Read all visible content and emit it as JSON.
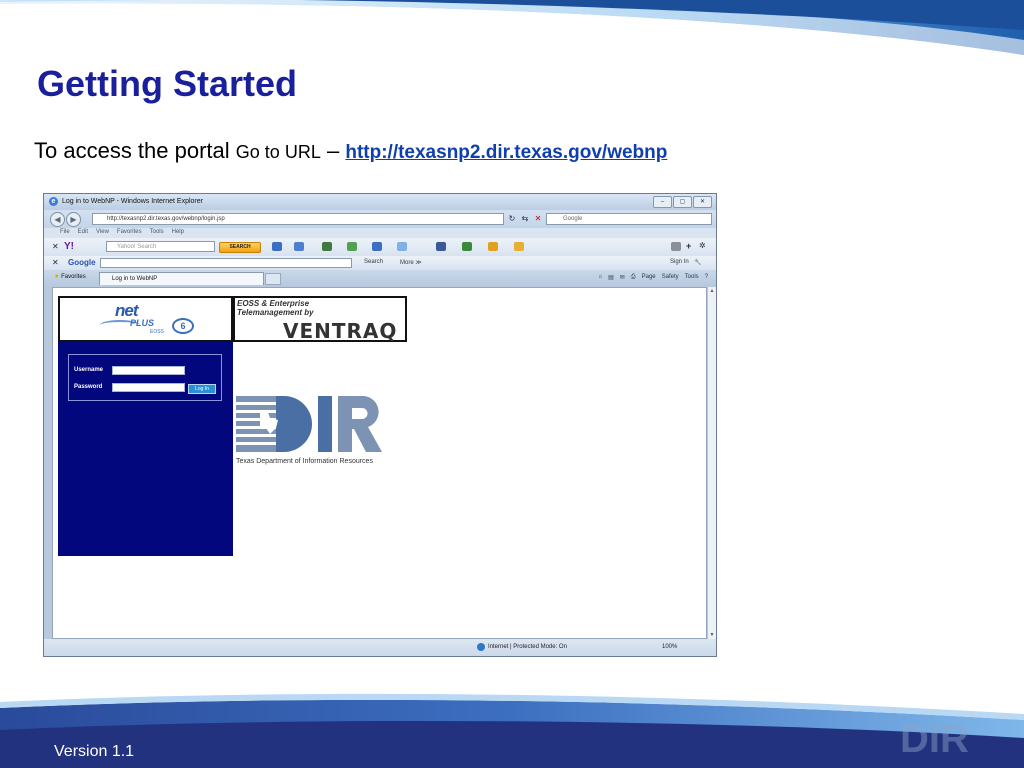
{
  "slide": {
    "title": "Getting Started",
    "intro_large": "To access the portal",
    "intro_small": "Go to URL",
    "dash": "–",
    "url": "http://texasnp2.dir.texas.gov/webnp",
    "version": "Version 1.1"
  },
  "browser": {
    "window_title": "Log in to WebNP - Windows Internet Explorer",
    "address": "http://texasnp2.dir.texas.gov/webnp/login.jsp",
    "search_placeholder": "Google",
    "menu": [
      "File",
      "Edit",
      "View",
      "Favorites",
      "Tools",
      "Help"
    ],
    "yahoo_search_placeholder": "Yahoo! Search",
    "yahoo_search_button": "SEARCH",
    "google_label": "Google",
    "google_search": "Search",
    "google_more": "More ≫",
    "sign_in": "Sign In",
    "favorites": "Favorites",
    "tab_title": "Log in to WebNP",
    "commands": [
      "Page",
      "Safety",
      "Tools"
    ],
    "status_text": "Internet | Protected Mode: On",
    "zoom": "100%"
  },
  "page": {
    "netplus_net": "net",
    "netplus_plus": "PLUS",
    "netplus_eoss": "EOSS",
    "netplus_version": "6",
    "eoss_line1": "EOSS & Enterprise",
    "eoss_line2": "Telemanagement by",
    "ventraq": "VENTRAQ",
    "username_label": "Username",
    "password_label": "Password",
    "login_button": "Log In",
    "dir_logo": "DIR",
    "dir_subtitle": "Texas Department of Information Resources"
  },
  "colors": {
    "title_blue": "#1a1f9c",
    "link_blue": "#0f3fae",
    "login_panel": "#03077d",
    "dir_blue": "#4a6fa5"
  }
}
